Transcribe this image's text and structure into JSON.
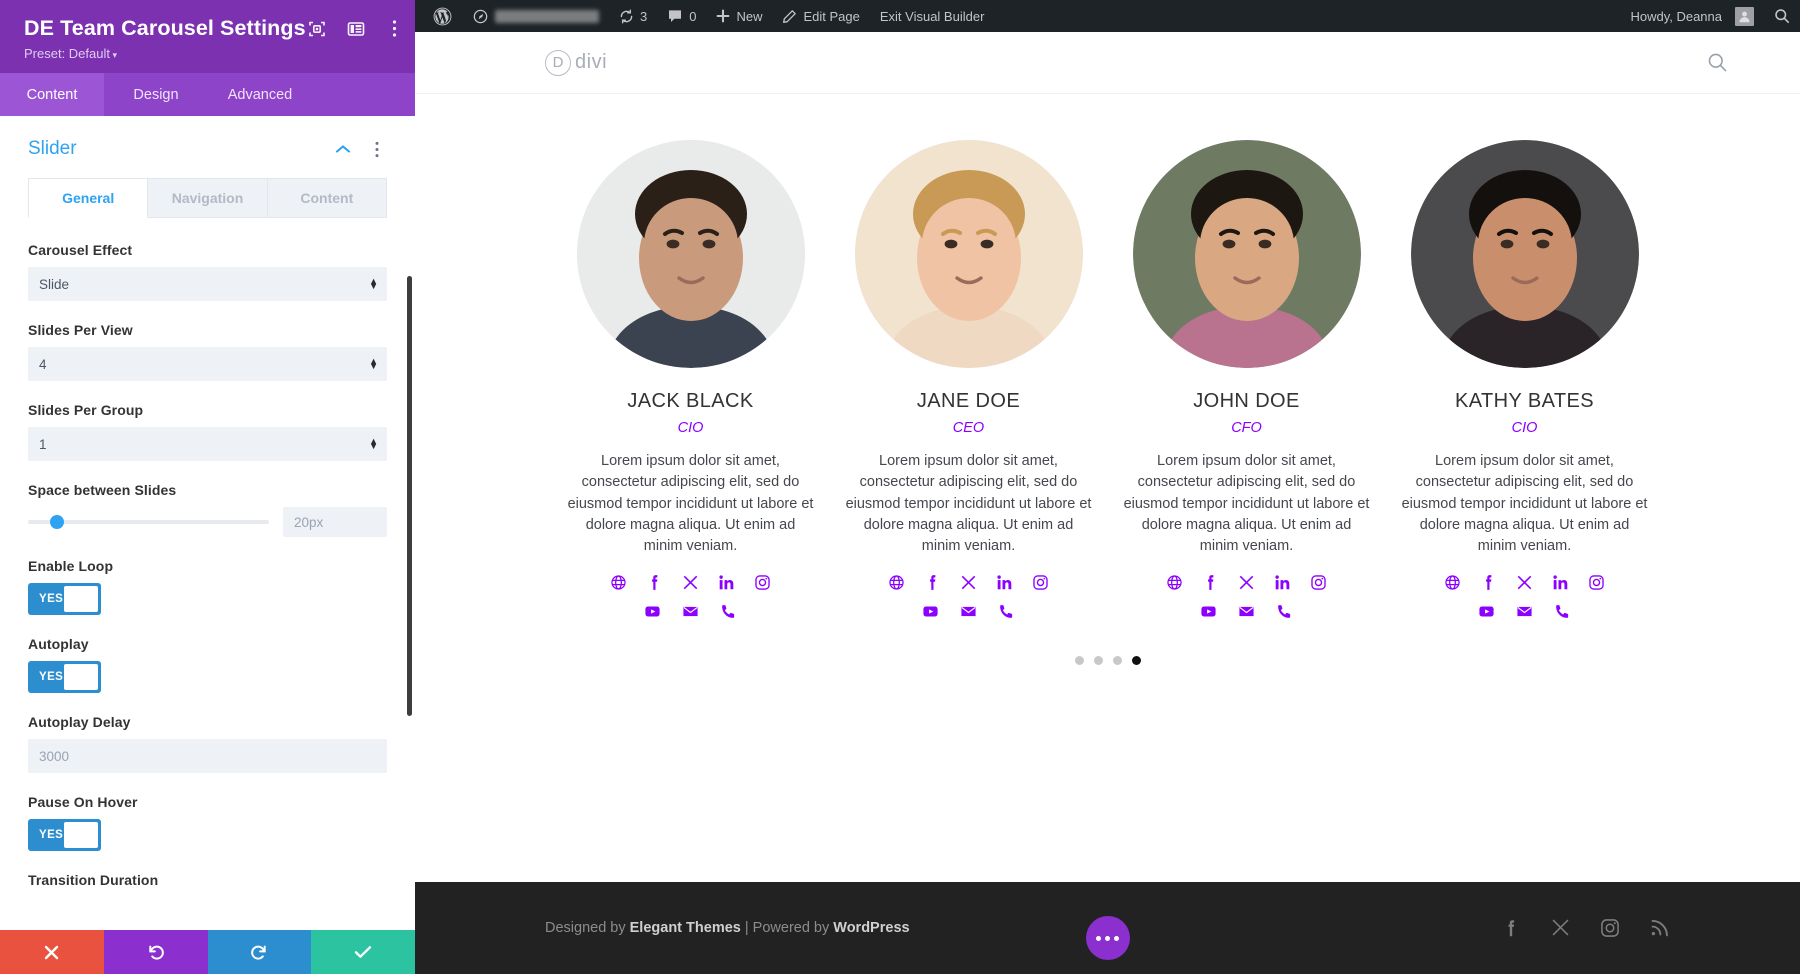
{
  "settings_panel": {
    "title": "DE Team Carousel Settings",
    "preset_label": "Preset: Default",
    "header_icons": [
      {
        "name": "focus-frame-icon"
      },
      {
        "name": "layout-columns-icon"
      },
      {
        "name": "more-vertical-icon"
      }
    ],
    "tabs": [
      {
        "label": "Content",
        "active": true
      },
      {
        "label": "Design",
        "active": false
      },
      {
        "label": "Advanced",
        "active": false
      }
    ],
    "section": {
      "title": "Slider",
      "collapse_icon": "chevron-up-icon",
      "more_icon": "more-vertical-icon"
    },
    "subtabs": [
      {
        "label": "General",
        "active": true
      },
      {
        "label": "Navigation",
        "active": false
      },
      {
        "label": "Content",
        "active": false
      }
    ],
    "fields": {
      "carousel_effect": {
        "label": "Carousel Effect",
        "value": "Slide"
      },
      "slides_per_view": {
        "label": "Slides Per View",
        "value": "4"
      },
      "slides_per_group": {
        "label": "Slides Per Group",
        "value": "1"
      },
      "space_between": {
        "label": "Space between Slides",
        "value": "20px",
        "percent": 9
      },
      "enable_loop": {
        "label": "Enable Loop",
        "value": "YES"
      },
      "autoplay": {
        "label": "Autoplay",
        "value": "YES"
      },
      "autoplay_delay": {
        "label": "Autoplay Delay",
        "value": "3000"
      },
      "pause_on_hover": {
        "label": "Pause On Hover",
        "value": "YES"
      },
      "transition_duration": {
        "label": "Transition Duration"
      }
    },
    "footer_buttons": [
      {
        "name": "cancel-button",
        "icon": "close-icon",
        "color": "#e8523f"
      },
      {
        "name": "undo-button",
        "icon": "undo-icon",
        "color": "#8b2fcf"
      },
      {
        "name": "redo-button",
        "icon": "redo-icon",
        "color": "#2d8ecf"
      },
      {
        "name": "save-button",
        "icon": "check-icon",
        "color": "#2cc3a0"
      }
    ]
  },
  "admin_bar": {
    "wp_logo": "wordpress-icon",
    "dashboard_icon": "dashboard-icon",
    "site_name": "",
    "updates_count": "3",
    "comments_count": "0",
    "new_label": "New",
    "edit_page_label": "Edit Page",
    "exit_builder_label": "Exit Visual Builder",
    "howdy_label": "Howdy, Deanna",
    "search_icon": "search-icon"
  },
  "site_header": {
    "logo_letter": "D",
    "logo_word": "divi",
    "search_icon": "search-icon"
  },
  "carousel": {
    "members": [
      {
        "name": "JACK BLACK",
        "role": "CIO",
        "bio": "Lorem ipsum dolor sit amet, consectetur adipiscing elit, sed do eiusmod tempor incididunt ut labore et dolore magna aliqua. Ut enim ad minim veniam.",
        "socials_row1": [
          "globe-icon",
          "facebook-icon",
          "x-twitter-icon",
          "linkedin-icon",
          "instagram-icon"
        ],
        "socials_row2": [
          "youtube-icon",
          "email-icon",
          "phone-icon"
        ],
        "photo": {
          "skin": "#c99a7c",
          "hair": "#2a2018",
          "bg": "#e9eaea",
          "shirt": "#3b4250"
        }
      },
      {
        "name": "JANE DOE",
        "role": "CEO",
        "bio": "Lorem ipsum dolor sit amet, consectetur adipiscing elit, sed do eiusmod tempor incididunt ut labore et dolore magna aliqua. Ut enim ad minim veniam.",
        "socials_row1": [
          "globe-icon",
          "facebook-icon",
          "x-twitter-icon",
          "linkedin-icon",
          "instagram-icon"
        ],
        "socials_row2": [
          "youtube-icon",
          "email-icon",
          "phone-icon"
        ],
        "photo": {
          "skin": "#f0c3a4",
          "hair": "#c99a56",
          "bg": "#f2e3cf",
          "shirt": "#efd9c2"
        }
      },
      {
        "name": "JOHN DOE",
        "role": "CFO",
        "bio": "Lorem ipsum dolor sit amet, consectetur adipiscing elit, sed do eiusmod tempor incididunt ut labore et dolore magna aliqua. Ut enim ad minim veniam.",
        "socials_row1": [
          "globe-icon",
          "facebook-icon",
          "x-twitter-icon",
          "linkedin-icon",
          "instagram-icon"
        ],
        "socials_row2": [
          "youtube-icon",
          "email-icon",
          "phone-icon"
        ],
        "photo": {
          "skin": "#d9a882",
          "hair": "#1d1712",
          "bg": "#6f7a63",
          "shirt": "#b9738e"
        }
      },
      {
        "name": "KATHY BATES",
        "role": "CIO",
        "bio": "Lorem ipsum dolor sit amet, consectetur adipiscing elit, sed do eiusmod tempor incididunt ut labore et dolore magna aliqua. Ut enim ad minim veniam.",
        "socials_row1": [
          "globe-icon",
          "facebook-icon",
          "x-twitter-icon",
          "linkedin-icon",
          "instagram-icon"
        ],
        "socials_row2": [
          "youtube-icon",
          "email-icon",
          "phone-icon"
        ],
        "photo": {
          "skin": "#c98f6d",
          "hair": "#14100e",
          "bg": "#4b4a4c",
          "shirt": "#2a2428"
        }
      }
    ],
    "pagination": {
      "count": 4,
      "active_index": 3
    }
  },
  "site_footer": {
    "designed_prefix": "Designed by ",
    "designed_brand": "Elegant Themes",
    "separator": " | ",
    "powered_prefix": "Powered by ",
    "powered_brand": "WordPress",
    "socials": [
      "facebook-icon",
      "x-twitter-icon",
      "instagram-icon",
      "rss-icon"
    ]
  },
  "floating_button": {
    "name": "divi-menu-button",
    "icon": "ellipsis-icon"
  },
  "colors": {
    "panel_purple": "#7f32b5",
    "tabs_purple": "#8e44c8",
    "accent_blue": "#2ea3f2",
    "social_purple": "#8b00ff",
    "admin_dark": "#1d2327",
    "footer_dark": "#222222"
  }
}
